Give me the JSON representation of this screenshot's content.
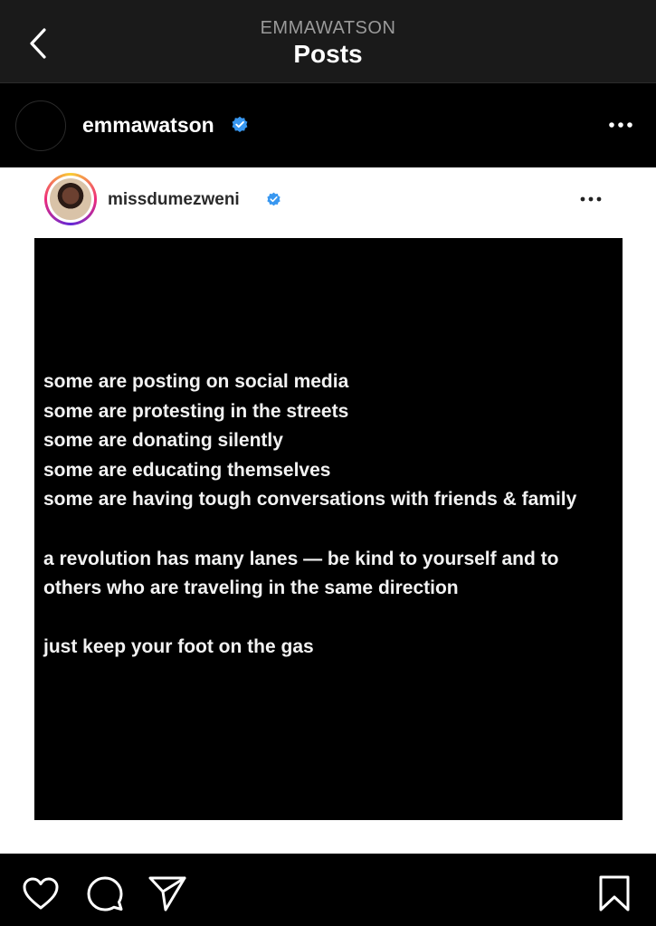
{
  "header": {
    "subtitle": "EMMAWATSON",
    "title": "Posts"
  },
  "post": {
    "author": "emmawatson",
    "verified_color": "#3897f0",
    "image": {
      "inner_author": "missdumezweni",
      "lines_group1": [
        "some are posting on social media",
        "some are protesting in the streets",
        "some are donating silently",
        "some are educating themselves",
        "some are having tough conversations with friends & family"
      ],
      "lines_group2": [
        "a revolution has many lanes — be kind to yourself and to",
        "others who are traveling in the same direction"
      ],
      "lines_group3": [
        "just keep your foot on the gas"
      ]
    }
  },
  "icons": {
    "back": "chevron-left-icon",
    "more": "more-horizontal-icon",
    "like": "heart-icon",
    "comment": "comment-icon",
    "share": "paper-plane-icon",
    "save": "bookmark-icon",
    "verified": "verified-badge-icon"
  }
}
